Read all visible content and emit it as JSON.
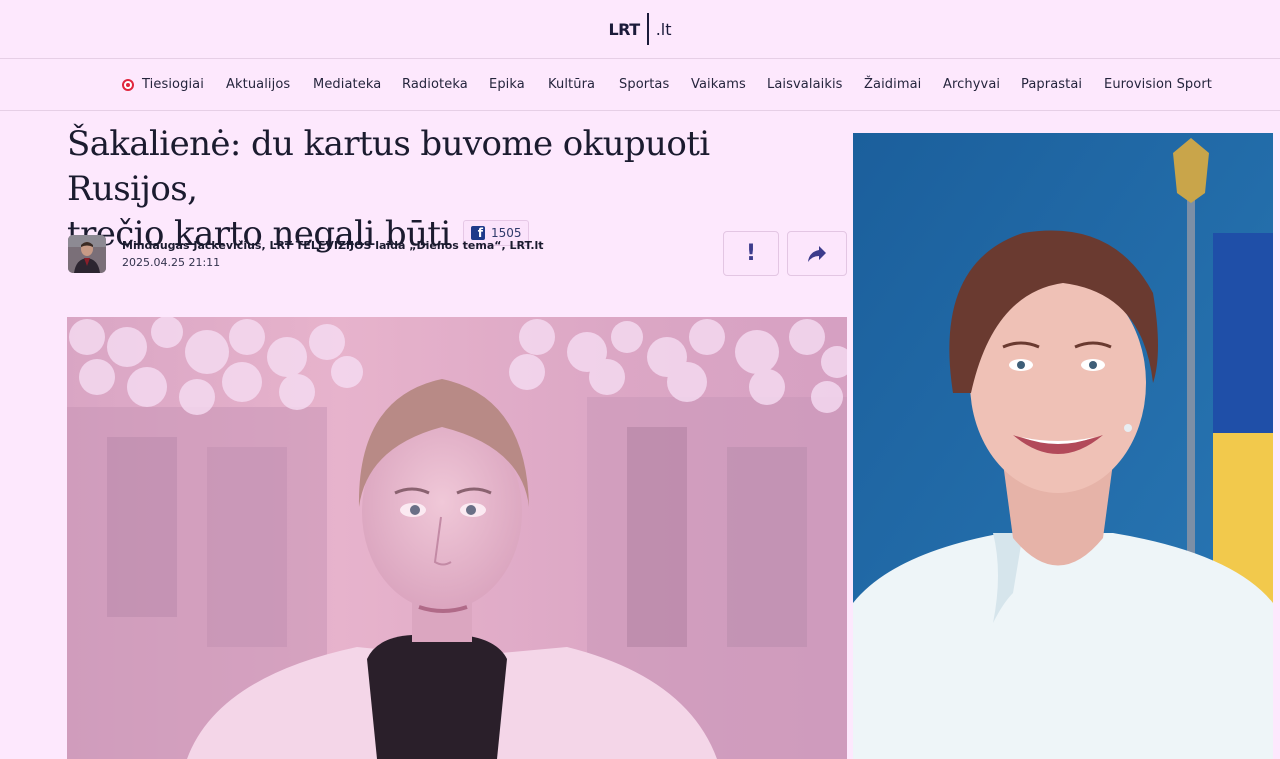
{
  "header": {
    "logo_text": "LRT",
    "logo_domain": ".lt"
  },
  "nav": {
    "live_label": "Tiesiogiai",
    "items": [
      "Aktualijos",
      "Mediateka",
      "Radioteka",
      "Epika",
      "Kultūra",
      "Sportas",
      "Vaikams",
      "Laisvalaikis",
      "Žaidimai",
      "Archyvai",
      "Paprastai",
      "Eurovision Sport"
    ]
  },
  "article": {
    "title_line1": "Šakalienė: du kartus buvome okupuoti Rusijos,",
    "title_line2": "trečio karto negali būti",
    "fb_count": "1505",
    "author": "Mindaugas Jackevičius, LRT TELEVIZIJOS laida „Dienos tema“, LRT.lt",
    "date": "2025.04.25 21:11",
    "report_label": "!"
  },
  "icons": {
    "facebook": "facebook-icon",
    "share": "share-arrow-icon",
    "live": "live-dot-icon"
  },
  "colors": {
    "background": "#fde8fd",
    "live_red": "#e0263e",
    "accent_blue": "#3c3c8c",
    "facebook_blue": "#1e3a8a"
  }
}
